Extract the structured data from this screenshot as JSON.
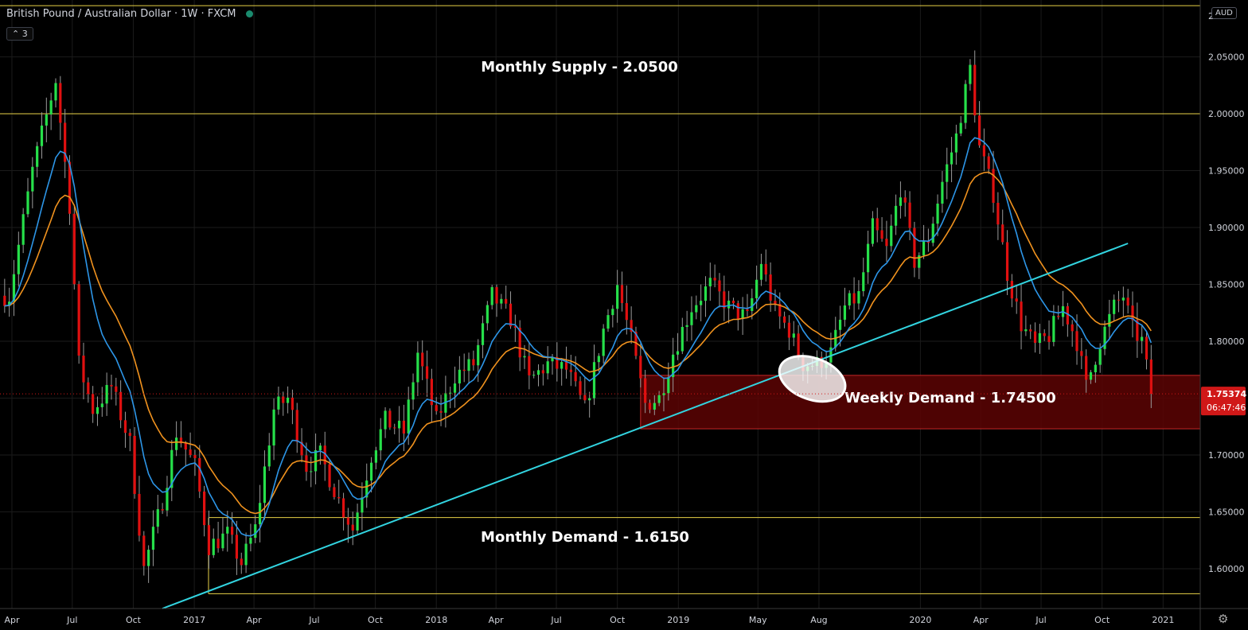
{
  "header": {
    "symbol": "British Pound / Australian Dollar",
    "interval": "1W",
    "broker": "FXCM",
    "sep": "·",
    "indicator_count": "3",
    "currency": "AUD"
  },
  "colors": {
    "background": "#000000",
    "grid": "#1b1b1b",
    "bull": "#26e04a",
    "bear": "#e01010",
    "ema_fast": "#2d96e8",
    "ema_slow": "#f0921e",
    "trendline": "#32d4e0",
    "level": "#e8d247",
    "zone": "#5c0404",
    "zone_border": "#c62828",
    "price_tag": "#d01818",
    "ellipse": "#ffffff"
  },
  "chart_data": {
    "type": "candlestick",
    "ylim": [
      1.565,
      2.1
    ],
    "x_tick_labels": [
      "Apr",
      "Jul",
      "Oct",
      "2017",
      "Apr",
      "Jul",
      "Oct",
      "2018",
      "Apr",
      "Jul",
      "Oct",
      "2019",
      "May",
      "Aug",
      "2020",
      "Apr",
      "Jul",
      "Oct",
      "2021"
    ],
    "y_tick_values": [
      1.6,
      1.65,
      1.7,
      1.75,
      1.8,
      1.85,
      1.9,
      1.95,
      2.0,
      2.05
    ],
    "y_tick_labels": [
      "1.60000",
      "1.65000",
      "1.70000",
      "1.75000",
      "1.80000",
      "1.85000",
      "1.90000",
      "1.95000",
      "2.00000",
      "2.05000"
    ],
    "y_top_partial_label": "2",
    "last_price": 1.75374,
    "last_price_label": "1.75374",
    "countdown_label": "06:47:46",
    "levels": [
      {
        "value": 2.095
      },
      {
        "value": 2.0
      },
      {
        "value": 1.645
      },
      {
        "value": 1.578
      }
    ],
    "zones": [
      {
        "top": 1.77,
        "bottom": 1.723,
        "start_date": "2018-11-05"
      }
    ],
    "annotations": [
      {
        "text": "Monthly Supply - 2.0500"
      },
      {
        "text": "Weekly Demand - 1.74500"
      },
      {
        "text": "Monthly Demand - 1.6150"
      }
    ],
    "trendline": {
      "start": {
        "date": "2016-11-14",
        "value": 1.565
      },
      "end": {
        "date": "2020-11-09",
        "value": 1.886
      }
    },
    "highlight_ellipse": {
      "date": "2019-07-22",
      "value": 1.767
    },
    "close_path": [
      {
        "date": "2016-03-28",
        "value": 1.84
      },
      {
        "date": "2016-05-02",
        "value": 1.95
      },
      {
        "date": "2016-06-06",
        "value": 2.03
      },
      {
        "date": "2016-06-27",
        "value": 1.92
      },
      {
        "date": "2016-07-11",
        "value": 1.78
      },
      {
        "date": "2016-08-01",
        "value": 1.74
      },
      {
        "date": "2016-08-29",
        "value": 1.76
      },
      {
        "date": "2016-09-26",
        "value": 1.71
      },
      {
        "date": "2016-10-17",
        "value": 1.6
      },
      {
        "date": "2016-11-14",
        "value": 1.66
      },
      {
        "date": "2016-12-05",
        "value": 1.72
      },
      {
        "date": "2017-01-02",
        "value": 1.69
      },
      {
        "date": "2017-01-23",
        "value": 1.62
      },
      {
        "date": "2017-02-20",
        "value": 1.63
      },
      {
        "date": "2017-03-13",
        "value": 1.605
      },
      {
        "date": "2017-04-03",
        "value": 1.635
      },
      {
        "date": "2017-05-01",
        "value": 1.74
      },
      {
        "date": "2017-05-22",
        "value": 1.75
      },
      {
        "date": "2017-06-19",
        "value": 1.69
      },
      {
        "date": "2017-07-10",
        "value": 1.7
      },
      {
        "date": "2017-08-07",
        "value": 1.66
      },
      {
        "date": "2017-08-28",
        "value": 1.635
      },
      {
        "date": "2017-09-25",
        "value": 1.7
      },
      {
        "date": "2017-10-16",
        "value": 1.73
      },
      {
        "date": "2017-11-13",
        "value": 1.72
      },
      {
        "date": "2017-12-04",
        "value": 1.79
      },
      {
        "date": "2018-01-01",
        "value": 1.73
      },
      {
        "date": "2018-01-29",
        "value": 1.77
      },
      {
        "date": "2018-02-26",
        "value": 1.78
      },
      {
        "date": "2018-03-26",
        "value": 1.84
      },
      {
        "date": "2018-04-23",
        "value": 1.82
      },
      {
        "date": "2018-05-21",
        "value": 1.765
      },
      {
        "date": "2018-06-18",
        "value": 1.78
      },
      {
        "date": "2018-07-16",
        "value": 1.775
      },
      {
        "date": "2018-08-13",
        "value": 1.74
      },
      {
        "date": "2018-09-10",
        "value": 1.81
      },
      {
        "date": "2018-10-01",
        "value": 1.85
      },
      {
        "date": "2018-10-22",
        "value": 1.8
      },
      {
        "date": "2018-11-12",
        "value": 1.745
      },
      {
        "date": "2018-12-03",
        "value": 1.75
      },
      {
        "date": "2018-12-24",
        "value": 1.79
      },
      {
        "date": "2019-01-21",
        "value": 1.83
      },
      {
        "date": "2019-02-18",
        "value": 1.85
      },
      {
        "date": "2019-03-18",
        "value": 1.83
      },
      {
        "date": "2019-04-15",
        "value": 1.82
      },
      {
        "date": "2019-05-06",
        "value": 1.87
      },
      {
        "date": "2019-05-27",
        "value": 1.825
      },
      {
        "date": "2019-06-17",
        "value": 1.81
      },
      {
        "date": "2019-07-08",
        "value": 1.78
      },
      {
        "date": "2019-07-29",
        "value": 1.78
      },
      {
        "date": "2019-08-19",
        "value": 1.79
      },
      {
        "date": "2019-09-09",
        "value": 1.83
      },
      {
        "date": "2019-09-30",
        "value": 1.84
      },
      {
        "date": "2019-10-21",
        "value": 1.9
      },
      {
        "date": "2019-11-11",
        "value": 1.88
      },
      {
        "date": "2019-12-02",
        "value": 1.935
      },
      {
        "date": "2019-12-23",
        "value": 1.87
      },
      {
        "date": "2020-01-13",
        "value": 1.89
      },
      {
        "date": "2020-02-03",
        "value": 1.94
      },
      {
        "date": "2020-02-24",
        "value": 1.98
      },
      {
        "date": "2020-03-16",
        "value": 2.04
      },
      {
        "date": "2020-03-30",
        "value": 1.97
      },
      {
        "date": "2020-04-20",
        "value": 1.93
      },
      {
        "date": "2020-05-11",
        "value": 1.86
      },
      {
        "date": "2020-06-01",
        "value": 1.815
      },
      {
        "date": "2020-06-22",
        "value": 1.795
      },
      {
        "date": "2020-07-13",
        "value": 1.805
      },
      {
        "date": "2020-08-03",
        "value": 1.83
      },
      {
        "date": "2020-08-24",
        "value": 1.8
      },
      {
        "date": "2020-09-07",
        "value": 1.76
      },
      {
        "date": "2020-09-28",
        "value": 1.8
      },
      {
        "date": "2020-10-19",
        "value": 1.83
      },
      {
        "date": "2020-11-02",
        "value": 1.84
      },
      {
        "date": "2020-11-16",
        "value": 1.81
      },
      {
        "date": "2020-11-30",
        "value": 1.8
      },
      {
        "date": "2020-12-14",
        "value": 1.75374
      }
    ]
  }
}
